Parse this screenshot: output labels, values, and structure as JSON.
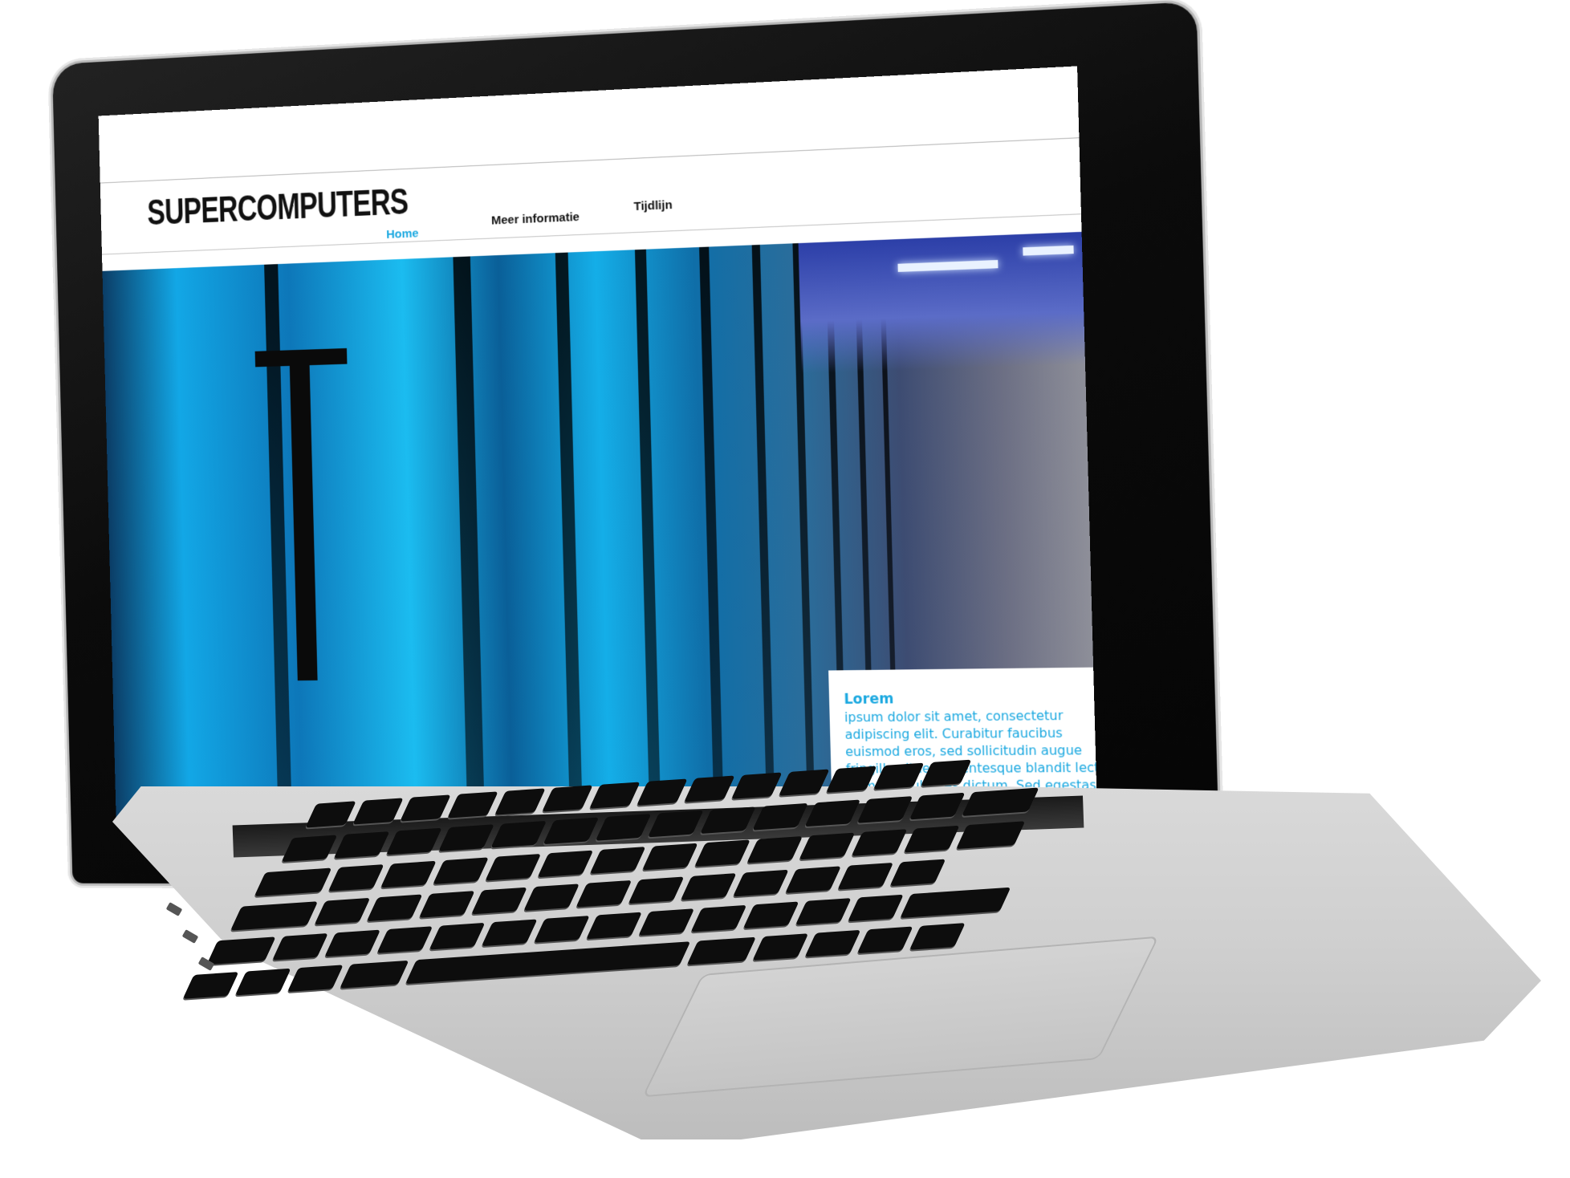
{
  "site": {
    "title": "SUPERCOMPUTERS",
    "nav": [
      {
        "label": "Home",
        "active": true
      },
      {
        "label": "Meer informatie",
        "active": false
      },
      {
        "label": "Tijdlijn",
        "active": false
      }
    ]
  },
  "info_box": {
    "heading": "Lorem",
    "text": "ipsum dolor sit amet, consectetur adipiscing elit. Curabitur faucibus euismod eros, sed sollicitudin augue fringilla vitae. Pellentesque blandit lectus et mauris ultrices dictum. Sed egestas semper lacus nec dictum. Proin feugiat suscipit mattis. Sed et ipsum eget lectus maximus sagittis non vitae arcu. Nullam neque urna, gravida in ipsum ac, fringilla hendrerit"
  },
  "colors": {
    "accent": "#1aa8e0",
    "title_text": "#111111",
    "laptop_bezel": "#0b0b0b",
    "laptop_body": "#d0d0d0"
  },
  "hero": {
    "icon": "supercomputer-racks-photo"
  }
}
